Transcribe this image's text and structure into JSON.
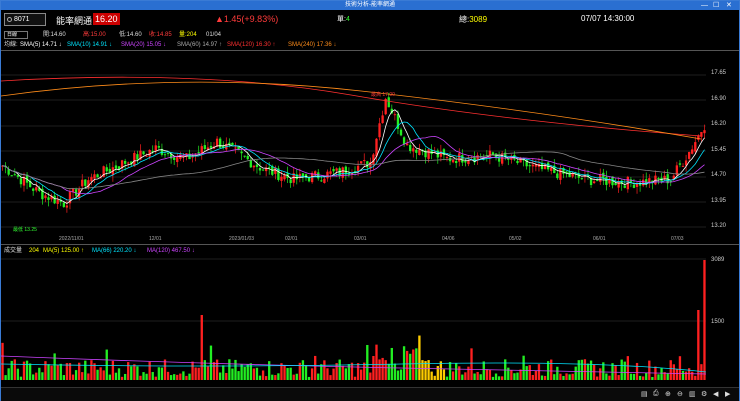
{
  "window": {
    "title": "技術分析-能率網通",
    "controls": [
      "—",
      "☐",
      "✕"
    ]
  },
  "header": {
    "stock_code": "8071",
    "stock_name": "能率網通",
    "price": "16.20",
    "change": "▲1.45(+9.83%)",
    "lot_label": "單:",
    "lot_value": "4",
    "volume_label": "總:",
    "volume_value": "3089",
    "datetime": "07/07 14:30:00"
  },
  "ohlc": {
    "period": "日線",
    "open": "開:14.60",
    "high": "高:15.00",
    "low": "低:14.60",
    "close": "收:14.85",
    "volume": "量:204",
    "date": "01/04"
  },
  "ma_bar": {
    "label": "均線:",
    "sma5": "SMA(5) 14.71 ↓",
    "sma10": "SMA(10) 14.91 ↓",
    "sma20": "SMA(20) 15.05 ↓",
    "sma60": "SMA(60) 14.97 ↑",
    "sma120": "SMA(120) 16.30 ↑",
    "sma240": "SMA(240) 17.36 ↓"
  },
  "price_axis": [
    "17.65",
    "16.90",
    "16.20",
    "15.45",
    "14.70",
    "13.95",
    "13.20"
  ],
  "volume_axis": [
    "3089",
    "1500"
  ],
  "x_axis": [
    "2022/11/01",
    "12/01",
    "2023/01/03",
    "02/01",
    "03/01",
    "04/06",
    "05/02",
    "06/01",
    "07/03"
  ],
  "annotations": {
    "high_mark": "最高 17.00",
    "low_mark": "最低 13.25"
  },
  "volume_header": {
    "label": "成交量",
    "value": "204",
    "ma5": "MA(5) 125.00 ↑",
    "ma66": "MA(66) 220.20 ↓",
    "ma120": "MA(120) 467.50 ↓"
  },
  "colors": {
    "up": "#ff2020",
    "down": "#22ee22",
    "sma5": "#ffffff",
    "sma10": "#00e5ff",
    "sma20": "#cc44ff",
    "sma60": "#888888",
    "sma120": "#ff3030",
    "sma240": "#ff8c1a",
    "accent": "#2a6fd1"
  },
  "status_icons": [
    "save-icon",
    "print-icon",
    "zoom-in-icon",
    "zoom-out-icon",
    "chart-type-icon",
    "settings-icon",
    "nav-left-icon",
    "nav-right-icon"
  ]
}
